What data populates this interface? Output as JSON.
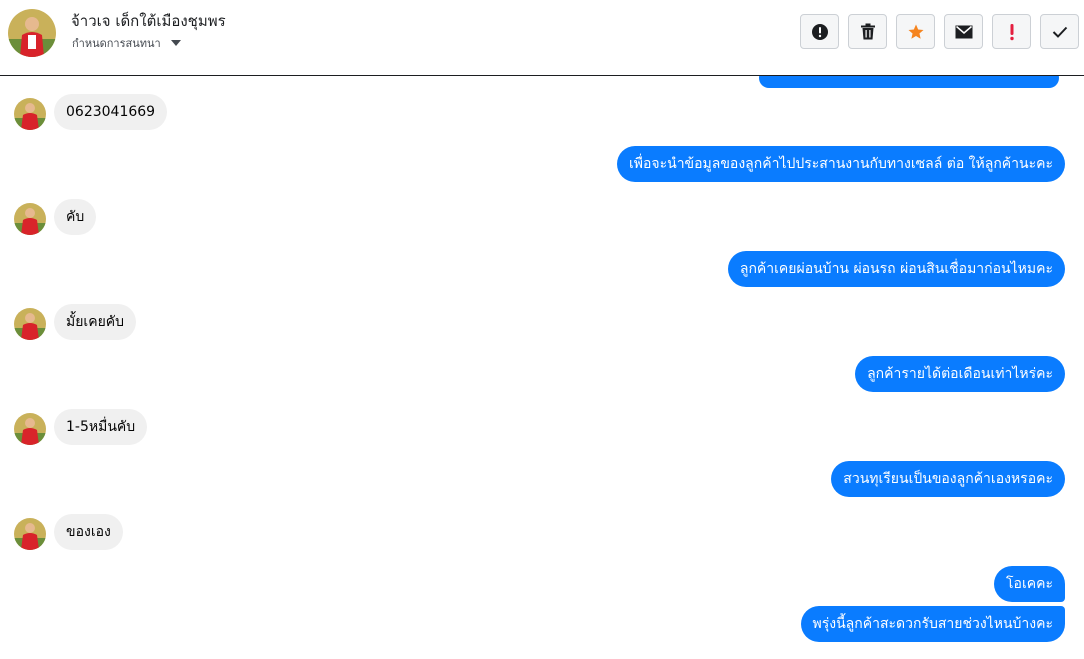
{
  "header": {
    "contact_name": "จ้าวเจ เด็กใต้เมืองชุมพร",
    "assign_label": "กำหนดการสนทนา"
  },
  "toolbar": {
    "buttons": [
      {
        "name": "alert-circle",
        "icon": "exclamation-circle-icon"
      },
      {
        "name": "delete",
        "icon": "trash-icon"
      },
      {
        "name": "star",
        "icon": "star-icon"
      },
      {
        "name": "mail",
        "icon": "envelope-icon"
      },
      {
        "name": "flag",
        "icon": "exclamation-icon"
      },
      {
        "name": "done",
        "icon": "checkmark-icon"
      }
    ]
  },
  "colors": {
    "outgoing_bubble": "#0a7cff",
    "incoming_bubble": "#f0f0f0",
    "star": "#f5841f",
    "exclamation_red": "#e41e3f"
  },
  "messages": [
    {
      "dir": "in",
      "text": "0623041669"
    },
    {
      "dir": "out",
      "text": "เพื่อจะนำข้อมูลของลูกค้าไปประสานงานกับทางเซลล์ ต่อ ให้ลูกค้านะคะ"
    },
    {
      "dir": "in",
      "text": "คับ"
    },
    {
      "dir": "out",
      "text": "ลูกค้าเคยผ่อนบ้าน  ผ่อนรถ  ผ่อนสินเชื่อมาก่อนไหมคะ"
    },
    {
      "dir": "in",
      "text": "มั้ยเคยคับ"
    },
    {
      "dir": "out",
      "text": "ลูกค้ารายได้ต่อเดือนเท่าไหร่คะ"
    },
    {
      "dir": "in",
      "text": "1-5หมื่นคับ"
    },
    {
      "dir": "out",
      "text": "สวนทุเรียนเป็นของลูกค้าเองหรอคะ"
    },
    {
      "dir": "in",
      "text": "ของเอง"
    },
    {
      "dir": "out",
      "text": "โอเคคะ"
    },
    {
      "dir": "out",
      "text": "พรุ่งนี้ลูกค้าสะดวกรับสายช่วงไหนบ้างคะ"
    }
  ]
}
